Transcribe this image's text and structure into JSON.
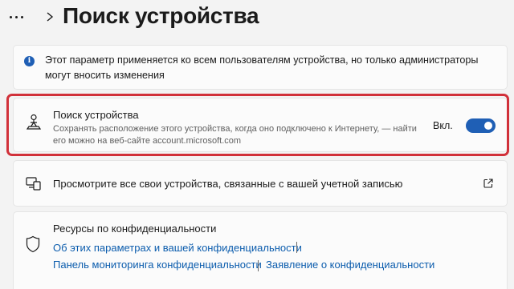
{
  "header": {
    "more_icon": "more-dots-icon",
    "chevron_icon": "chevron-right-icon",
    "title": "Поиск устройства"
  },
  "info": {
    "icon": "info-icon",
    "icon_glyph": "i",
    "text": "Этот параметр применяется ко всем пользователям устройства, но только администраторы могут вносить изменения"
  },
  "find_device": {
    "icon": "person-location-icon",
    "title": "Поиск устройства",
    "description": "Сохранять расположение этого устройства, когда оно подключено к Интернету, — найти его можно на веб-сайте account.microsoft.com",
    "toggle_label": "Вкл.",
    "toggle_on": true,
    "highlight_color": "#d1313a"
  },
  "devices_link": {
    "icon": "devices-icon",
    "text": "Просмотрите все свои устройства, связанные с вашей учетной записью",
    "external_icon": "open-external-icon"
  },
  "privacy": {
    "icon": "shield-icon",
    "title": "Ресурсы по конфиденциальности",
    "links": [
      "Об этих параметрах и вашей конфиденциальности",
      "Панель мониторинга конфиденциальности",
      "Заявление о конфиденциальности"
    ]
  },
  "colors": {
    "accent": "#1f5fb5",
    "link": "#0b5cad",
    "background": "#f3f3f3",
    "card": "#fbfbfb"
  }
}
